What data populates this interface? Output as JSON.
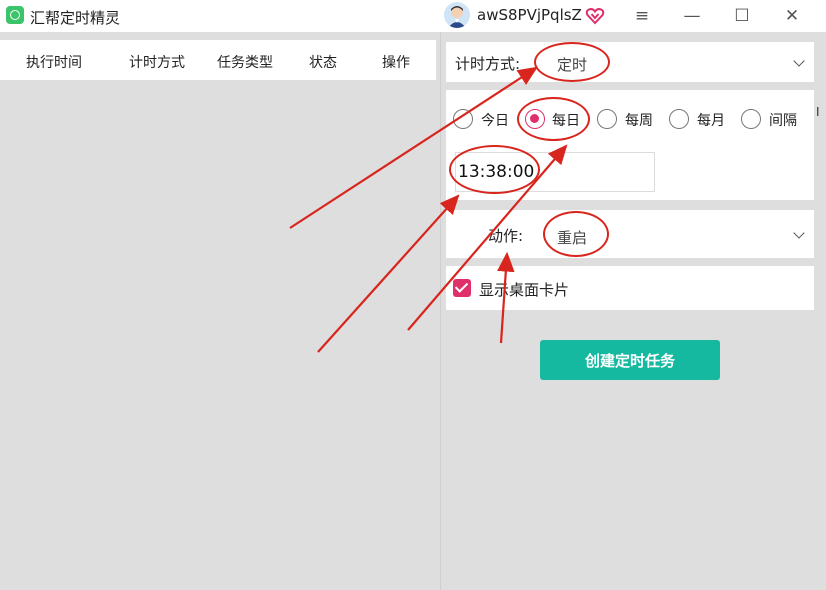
{
  "app": {
    "title": "汇帮定时精灵",
    "icon": "alarm-clock-icon",
    "brand_color": "#3cc46a"
  },
  "user": {
    "name": "awS8PVjPqlsZ",
    "avatar_icon": "user-avatar-icon",
    "badge_icon": "vip-heart-icon"
  },
  "window_controls": {
    "menu": "≡",
    "minimize": "—",
    "maximize": "☐",
    "close": "✕"
  },
  "table": {
    "columns": [
      "执行时间",
      "计时方式",
      "任务类型",
      "状态",
      "操作"
    ]
  },
  "timing": {
    "label": "计时方式:",
    "selected": "定时"
  },
  "schedule": {
    "options": [
      "今日",
      "每日",
      "每周",
      "每月",
      "间隔"
    ],
    "selected_index": 1,
    "time_value": "13:38:00"
  },
  "action": {
    "label": "动作:",
    "selected": "重启"
  },
  "desktop_card": {
    "label": "显示桌面卡片",
    "checked": true
  },
  "create_button": {
    "label": "创建定时任务"
  },
  "edge_fragment": {
    "text": "I"
  },
  "colors": {
    "accent": "#e0306a",
    "button": "#15b9a0",
    "annotation": "#d8251d"
  }
}
